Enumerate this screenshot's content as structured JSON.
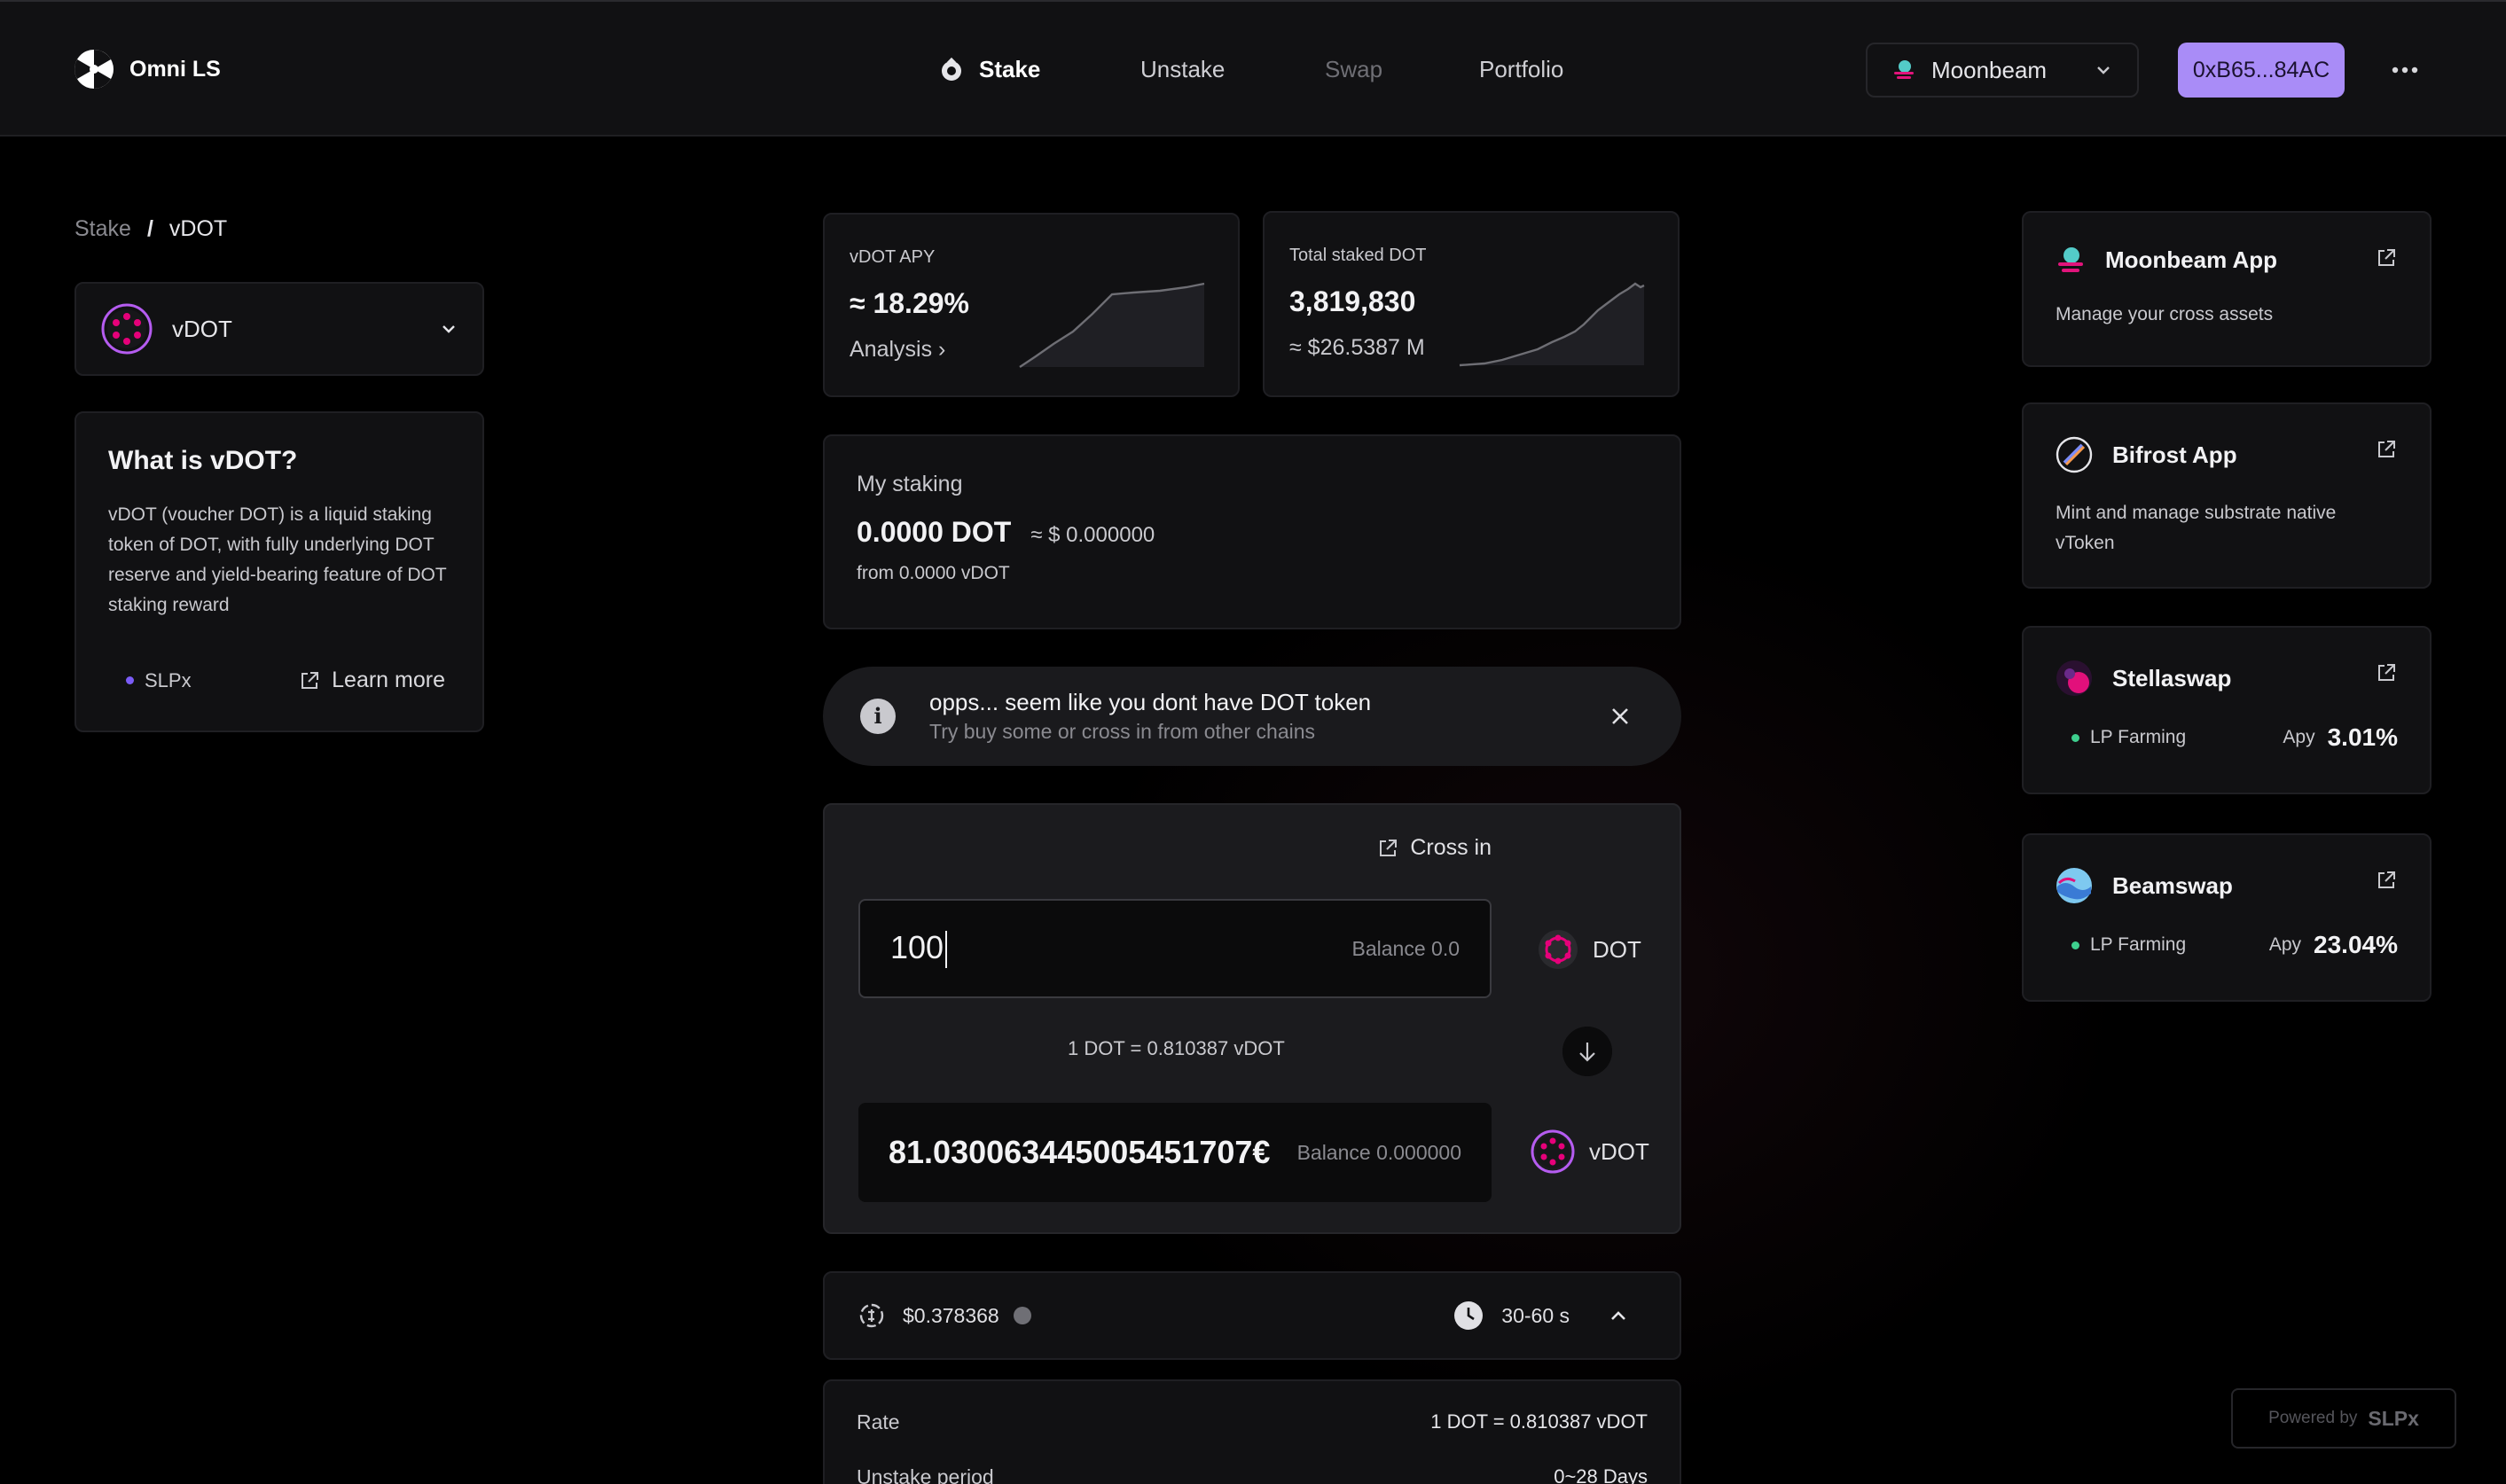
{
  "header": {
    "app_name": "Omni LS",
    "nav": [
      "Stake",
      "Unstake",
      "Swap",
      "Portfolio"
    ],
    "network": "Moonbeam",
    "wallet": "0xB65...84AC"
  },
  "breadcrumb": {
    "root": "Stake",
    "separator": "/",
    "current": "vDOT"
  },
  "token_select": {
    "label": "vDOT"
  },
  "what_is": {
    "title": "What is vDOT?",
    "description": "vDOT (voucher DOT) is a liquid staking token of DOT, with fully underlying DOT reserve and yield-bearing feature of DOT staking reward",
    "tag": "SLPx",
    "link": "Learn more"
  },
  "stats": {
    "apy": {
      "label": "vDOT APY",
      "value": "≈ 18.29%",
      "sub": "Analysis ›"
    },
    "total": {
      "label": "Total staked DOT",
      "value": "3,819,830",
      "sub": "≈ $26.5387 M"
    }
  },
  "my_staking": {
    "label": "My staking",
    "amount": "0.0000 DOT",
    "usd": "≈ $ 0.000000",
    "from": "from 0.0000 vDOT"
  },
  "alert": {
    "title": "opps... seem like you dont have DOT token",
    "subtitle": "Try buy some or cross in from other chains"
  },
  "swap": {
    "cross_in": "Cross in",
    "input_value": "100",
    "input_balance": "Balance 0.0",
    "input_token": "DOT",
    "rate": "1 DOT = 0.810387 vDOT",
    "output_value": "81.030063445005451707€",
    "output_balance": "Balance 0.000000",
    "output_token": "vDOT"
  },
  "fee": {
    "value": "$0.378368",
    "time": "30-60 s"
  },
  "details": {
    "rows": [
      {
        "label": "Rate",
        "value": "1 DOT = 0.810387 vDOT"
      },
      {
        "label": "Unstake period",
        "value": "0~28 Days"
      }
    ]
  },
  "side": {
    "moonbeam": {
      "title": "Moonbeam App",
      "desc": "Manage your cross assets"
    },
    "bifrost": {
      "title": "Bifrost App",
      "desc": "Mint and manage substrate native vToken"
    },
    "stellaswap": {
      "title": "Stellaswap",
      "farm": "LP Farming",
      "apy_label": "Apy",
      "apy": "3.01%"
    },
    "beamswap": {
      "title": "Beamswap",
      "farm": "LP Farming",
      "apy_label": "Apy",
      "apy": "23.04%"
    }
  },
  "powered": {
    "prefix": "Powered by",
    "brand": "SLPx"
  },
  "colors": {
    "accent": "#a98cf7",
    "polkadot": "#e6007a",
    "farm_green": "#3ecf8e",
    "slpx_dot": "#7b5cf7"
  }
}
